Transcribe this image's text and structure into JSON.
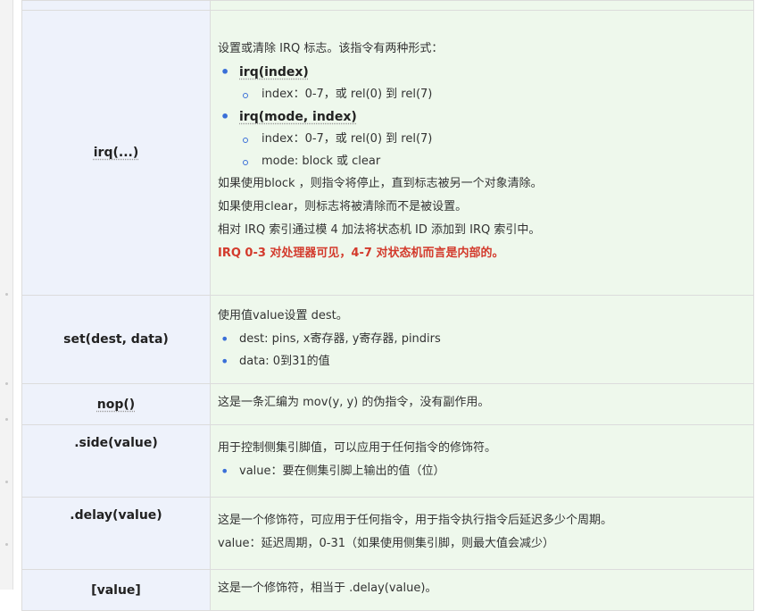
{
  "rows": {
    "irq": {
      "key": "irq(...)",
      "intro": "设置或清除 IRQ 标志。该指令有两种形式：",
      "form1": "irq(index)",
      "form1_sub1": "index：0-7，或 rel(0) 到 rel(7)",
      "form2": "irq(mode, index)",
      "form2_sub1": "index：0-7，或 rel(0) 到 rel(7)",
      "form2_sub2": "mode: block 或 clear",
      "p1": "如果使用block ，则指令将停止，直到标志被另一个对象清除。",
      "p2": "如果使用clear，则标志将被清除而不是被设置。",
      "p3": "相对 IRQ 索引通过模 4 加法将状态机 ID 添加到 IRQ 索引中。",
      "warn": "IRQ 0-3 对处理器可见，4-7 对状态机而言是内部的。"
    },
    "set": {
      "key": "set(dest, data)",
      "intro": "使用值value设置 dest。",
      "b1": "dest: pins, x寄存器, y寄存器, pindirs",
      "b2": "data: 0到31的值"
    },
    "nop": {
      "key": "nop()",
      "desc": "这是一条汇编为 mov(y, y) 的伪指令，没有副作用。"
    },
    "side": {
      "key": ".side(value)",
      "intro": "用于控制侧集引脚值，可以应用于任何指令的修饰符。",
      "b1": "value：要在侧集引脚上输出的值（位）"
    },
    "delay": {
      "key": ".delay(value)",
      "p1": "这是一个修饰符，可应用于任何指令，用于指令执行指令后延迟多少个周期。",
      "p2": "value：延迟周期，0-31（如果使用侧集引脚，则最大值会减少）"
    },
    "value": {
      "key": "[value]",
      "desc": "这是一个修饰符，相当于 .delay(value)。"
    }
  }
}
